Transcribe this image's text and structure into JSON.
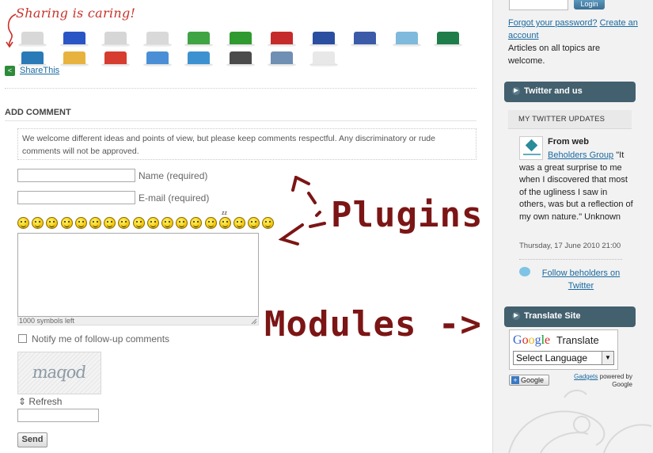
{
  "sharing": {
    "title": "Sharing is caring!",
    "share_icons": [
      {
        "name": "digg-icon",
        "color": "#d8d8d8"
      },
      {
        "name": "delicious-icon",
        "color": "#2a55c5"
      },
      {
        "name": "stumbleupon-icon",
        "color": "#d6d6d6"
      },
      {
        "name": "reddit-icon",
        "color": "#d9d9d9"
      },
      {
        "name": "technorati-icon",
        "color": "#3fa444"
      },
      {
        "name": "orkut-icon",
        "color": "#2f9a2f"
      },
      {
        "name": "gmail-icon",
        "color": "#c62b2b"
      },
      {
        "name": "myspace-icon",
        "color": "#2a4fa0"
      },
      {
        "name": "facebook-icon",
        "color": "#3b5ba9"
      },
      {
        "name": "twitter-icon",
        "color": "#7fb9dc"
      },
      {
        "name": "yammer-icon",
        "color": "#1e7d4a"
      },
      {
        "name": "linkedin-icon",
        "color": "#2a7ab8"
      },
      {
        "name": "google-icon",
        "color": "#e7b23e"
      },
      {
        "name": "google-plus-icon",
        "color": "#d63c2f"
      },
      {
        "name": "newsvine-icon",
        "color": "#4a8fd6"
      },
      {
        "name": "netvibes-icon",
        "color": "#3c92d0"
      },
      {
        "name": "printer-icon",
        "color": "#4b4b4b"
      },
      {
        "name": "email-icon",
        "color": "#6f8fb3"
      },
      {
        "name": "bookmark-icon",
        "color": "#e8e8e8"
      }
    ],
    "sharethis_label": "ShareThis"
  },
  "comment_form": {
    "heading": "ADD COMMENT",
    "notice": "We welcome different ideas and points of view, but please keep comments respectful. Any discriminatory or rude comments will not be approved.",
    "name_label": "Name (required)",
    "email_label": "E-mail (required)",
    "symbols_left": "1000 symbols left",
    "notify_label": "Notify me of follow-up comments",
    "captcha_text": "maqod",
    "refresh_label": "Refresh",
    "send_label": "Send",
    "smiley_count": 18
  },
  "annotations": {
    "plugins": "Plugins",
    "modules": "Modules ->"
  },
  "sidebar": {
    "login_label": "Login",
    "forgot_password": "Forgot your password?",
    "create_account": "Create an account",
    "articles_note": "Articles on all topics are welcome.",
    "twitter_module": {
      "title": "Twitter and us",
      "panel_title": "MY TWITTER UPDATES",
      "from": "From web",
      "author_link": "Beholders Group",
      "tweet": "\"It was a great surprise to me when I discovered that most of the ugliness I saw in others, was but a reflection of my own nature.\" Unknown",
      "date": "Thursday, 17 June 2010 21:00",
      "follow": "Follow beholders on Twitter"
    },
    "translate_module": {
      "title": "Translate Site",
      "google": "Google",
      "translate": "Translate",
      "select_value": "Select Language",
      "add_google": "Google",
      "gadgets": "Gadgets",
      "powered_by": "powered by Google"
    }
  },
  "colors": {
    "annotation": "#7c1515",
    "module_header": "#43606e",
    "link": "#1a6aa1",
    "sharing_title": "#c8322a"
  }
}
